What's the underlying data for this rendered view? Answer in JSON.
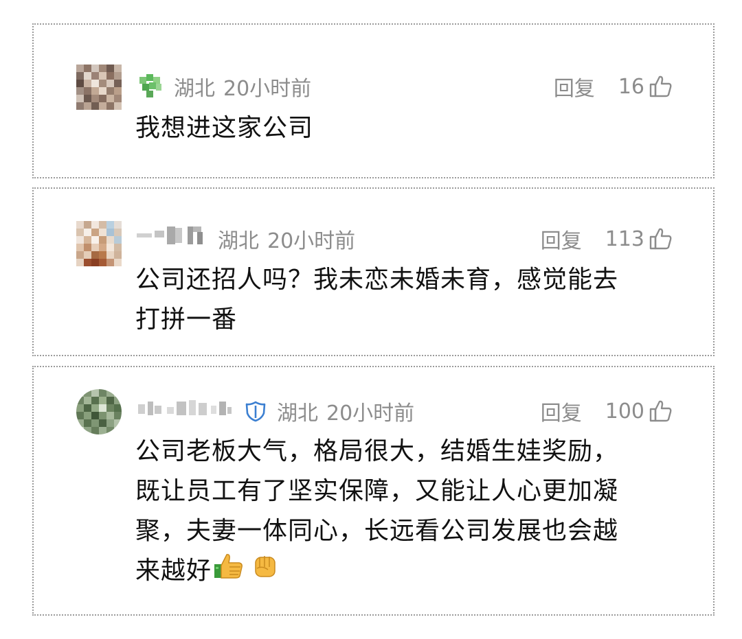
{
  "comments": [
    {
      "location": "湖北",
      "time": "20小时前",
      "reply_label": "回复",
      "likes": "16",
      "text": "我想进这家公司"
    },
    {
      "location": "湖北",
      "time": "20小时前",
      "reply_label": "回复",
      "likes": "113",
      "text_line1": "公司还招人吗？我未恋未婚未育，感觉能去",
      "text_line2": "打拼一番"
    },
    {
      "location": "湖北",
      "time": "20小时前",
      "reply_label": "回复",
      "likes": "100",
      "text_line1": "公司老板大气，格局很大，结婚生娃奖励，",
      "text_line2": "既让员工有了坚实保障，又能让人心更加凝",
      "text_line3": "聚，夫妻一体同心，长远看公司发展也会越",
      "text_line4": "来越好"
    }
  ],
  "icons": {
    "like": "thumbs-up-outline-icon",
    "badge1": "green-clover-badge-icon",
    "badge3": "blue-shield-badge-icon",
    "emoji1": "thumbs-up-emoji",
    "emoji2": "raised-fist-emoji"
  },
  "colors": {
    "meta_text": "#8c8c8c",
    "body_text": "#111111",
    "border": "#9a9a9a",
    "badge_green": "#5cb85c",
    "badge_blue": "#3b7fd1"
  }
}
